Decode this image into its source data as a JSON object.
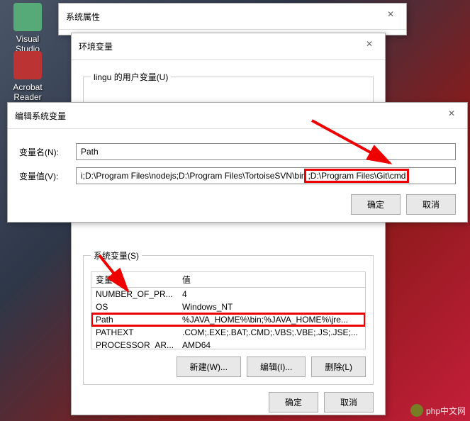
{
  "desktop": {
    "icon1_label": "Visual Studio Code",
    "icon2_label": "Acrobat Reader DC"
  },
  "sys_props": {
    "title": "系统属性"
  },
  "env_vars": {
    "title": "环境变量",
    "user_legend": "lingu 的用户变量(U)",
    "system_legend": "系统变量(S)",
    "col_var": "变量",
    "col_val": "值",
    "rows": [
      {
        "var": "NUMBER_OF_PR...",
        "val": "4"
      },
      {
        "var": "OS",
        "val": "Windows_NT"
      },
      {
        "var": "Path",
        "val": "%JAVA_HOME%\\bin;%JAVA_HOME%\\jre..."
      },
      {
        "var": "PATHEXT",
        "val": ".COM;.EXE;.BAT;.CMD;.VBS;.VBE;.JS;.JSE;..."
      },
      {
        "var": "PROCESSOR_AR...",
        "val": "AMD64"
      }
    ],
    "btn_new": "新建(W)...",
    "btn_edit": "编辑(I)...",
    "btn_delete": "删除(L)",
    "btn_ok": "确定",
    "btn_cancel": "取消"
  },
  "edit_var": {
    "title": "编辑系统变量",
    "label_name": "变量名(N):",
    "label_value": "变量值(V):",
    "name_value": "Path",
    "value_prefix": "i;D:\\Program Files\\nodejs;D:\\Program Files\\TortoiseSVN\\bin",
    "value_highlight": ";D:\\Program Files\\Git\\cmd",
    "btn_ok": "确定",
    "btn_cancel": "取消"
  },
  "watermark": {
    "text": "php中文网"
  }
}
